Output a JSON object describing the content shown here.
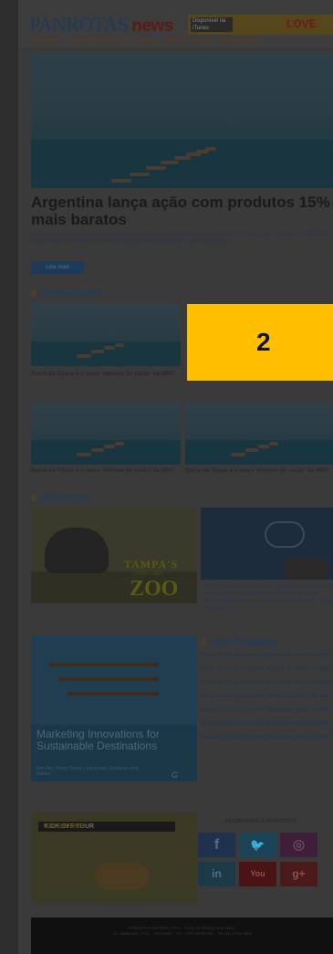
{
  "header": {
    "logo": "PANROTAS",
    "logo_suffix": "news",
    "banner_badge": "Disponível na iTunes",
    "banner_text": "LOVE"
  },
  "nav": {
    "items": [
      "SEMINÁRIOS",
      "VIAGENS CORPORATIVAS",
      "E-STORES",
      "PESSOAS MOTUAS",
      "COMO ANUNCIAR"
    ]
  },
  "hero": {
    "headline": "Argentina lança ação com produtos 15% mais baratos",
    "excerpt": "Em tempos de crise no Brasil, na América Latina e em tantas outras partes do mundo, como anular a instabilidade econômica e o receio do turista de viajar? Para responder a essa pergunta...",
    "read_more": "Leia mais"
  },
  "destaques": {
    "title": "DESTAQUES",
    "captions": [
      "Barra da Tijuca é o novo 'destino de verão' da MMT",
      "Barra da Tijuca é o novo 'destino de verão' da MMT",
      "Barra da Tijuca é o novo 'destino de verão' da MMT"
    ]
  },
  "overlay_marker": "2",
  "servicos": {
    "title": "SERVIÇOS",
    "zoo_title": "TAMPA'S",
    "zoo_sub": "LOWRY PARK",
    "zoo_word": "ZOO",
    "cloud_caption": "Conheça o Service Cloud, a solução em gestão de atendimento ao cliente da Salesforce. Mais flexibilidade e inteligência para sua equipe. Veja os recursos!"
  },
  "marketing": {
    "title": "Marketing Innovations for Sustainable Destinations",
    "sub": "Kim Filo, Pedro Torres, Luiz Kunes, Cristiane Lima Santos",
    "logo": "G"
  },
  "leia_tambem": {
    "title": "LEIA TAMBÉM",
    "items": [
      "Barra da Tijuca é o novo 'destino de verão' da MMT",
      "Barra da Tijuca é o novo 'destino de verão' da MMT",
      "Barra da Tijuca é o novo 'destino de verão' da MMT",
      "Barra da Tijuca é o novo 'destino de verão' da MMT",
      "Barra da Tijuca é o novo 'destino de verão' da MMT",
      "Barra da Tijuca é o novo 'destino de verão' da MMT",
      "Barra da Tijuca é o novo 'destino de verão' da MMT"
    ]
  },
  "safari": {
    "kick": "KICK OFF YOUR",
    "adventure": "ADVENTURE"
  },
  "social": {
    "title": "ACOMPANHE A PANROTAS",
    "icons": [
      {
        "name": "facebook",
        "glyph": "f",
        "color": "#1e3250"
      },
      {
        "name": "twitter",
        "glyph": "🐦",
        "color": "#1c4458"
      },
      {
        "name": "instagram",
        "glyph": "◎",
        "color": "#3e1e38"
      },
      {
        "name": "linkedin",
        "glyph": "in",
        "color": "#1a3a4a"
      },
      {
        "name": "youtube",
        "glyph": "You",
        "color": "#4a1414"
      },
      {
        "name": "googleplus",
        "glyph": "g+",
        "color": "#4a1a1a"
      }
    ]
  },
  "footer": {
    "line1": "PANROTAS EDITORA LTDA · Todos os direitos reservados",
    "line2": "Av. Jabaquara, 1761 · São Paulo · SP · CEP 04045-901 · Tel (11) 2764-4800"
  }
}
